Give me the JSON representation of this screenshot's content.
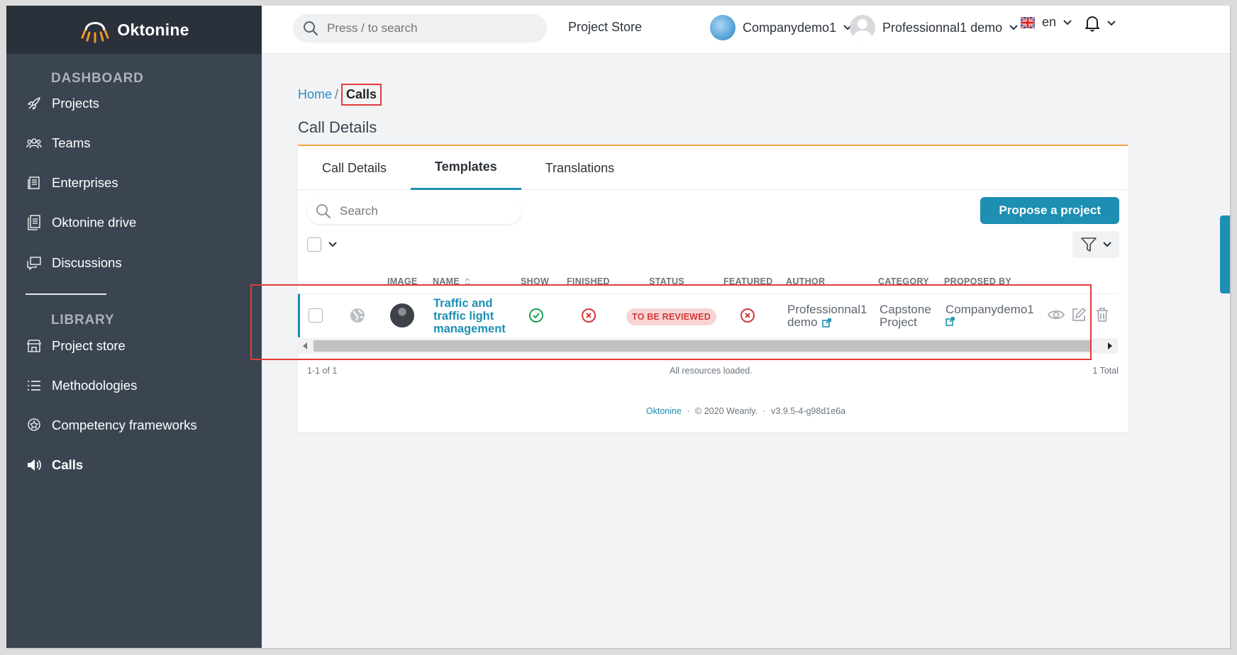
{
  "app": {
    "name": "Oktonine"
  },
  "sidebar": {
    "sections": [
      {
        "label": "DASHBOARD"
      },
      {
        "label": "LIBRARY"
      }
    ],
    "items": [
      {
        "label": "Projects",
        "icon": "rocket-icon"
      },
      {
        "label": "Teams",
        "icon": "team-icon"
      },
      {
        "label": "Enterprises",
        "icon": "enterprise-icon"
      },
      {
        "label": "Oktonine drive",
        "icon": "drive-icon"
      },
      {
        "label": "Discussions",
        "icon": "discussion-icon"
      },
      {
        "label": "Project store",
        "icon": "store-icon"
      },
      {
        "label": "Methodologies",
        "icon": "list-icon"
      },
      {
        "label": "Competency frameworks",
        "icon": "badge-icon"
      },
      {
        "label": "Calls",
        "icon": "megaphone-icon"
      }
    ],
    "active": "Calls"
  },
  "topbar": {
    "search_placeholder": "Press / to search",
    "project_store": "Project Store",
    "company": "Companydemo1",
    "user": "Professionnal1 demo",
    "language": "en"
  },
  "breadcrumb": {
    "home": "Home",
    "separator": "/",
    "current": "Calls"
  },
  "page": {
    "title": "Call Details"
  },
  "tabs": [
    {
      "label": "Call Details"
    },
    {
      "label": "Templates"
    },
    {
      "label": "Translations"
    }
  ],
  "active_tab": "Templates",
  "toolbar": {
    "search_placeholder": "Search",
    "propose_label": "Propose a project"
  },
  "table": {
    "columns": {
      "image": "IMAGE",
      "name": "NAME",
      "show": "SHOW",
      "finished": "FINISHED",
      "status": "STATUS",
      "featured": "FEATURED",
      "author": "AUTHOR",
      "category": "CATEGORY",
      "proposed_by": "PROPOSED BY"
    },
    "rows": [
      {
        "name": [
          "Traffic and",
          "traffic light",
          "management"
        ],
        "show": true,
        "finished": false,
        "status": "TO BE REVIEWED",
        "featured": false,
        "author": [
          "Professionnal1",
          "demo"
        ],
        "category": [
          "Capstone",
          "Project"
        ],
        "proposed_by": "Companydemo1"
      }
    ]
  },
  "footer": {
    "range": "1-1 of 1",
    "loaded": "All resources loaded.",
    "total": "1 Total"
  },
  "site_footer": {
    "brand": "Oktonine",
    "copyright": "© 2020 Weanly.",
    "version": "v3.9.5-4-g98d1e6a",
    "dot": "·"
  },
  "colors": {
    "accent": "#1d8fb3",
    "sidebar": "#3b4552",
    "highlight": "#e23b3b",
    "tab_border": "#f0a43a"
  }
}
